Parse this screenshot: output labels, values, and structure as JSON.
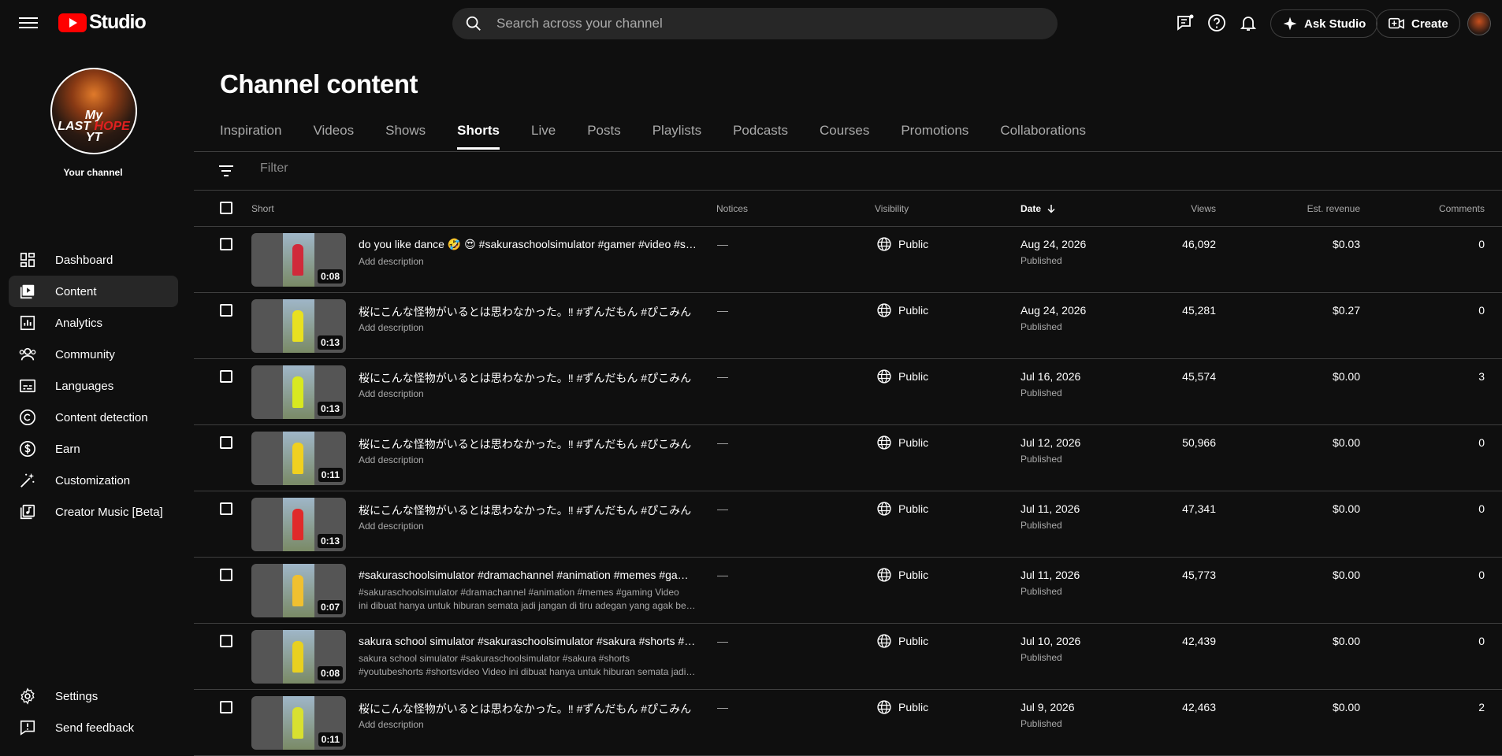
{
  "app": {
    "logo_text": "Studio"
  },
  "search": {
    "placeholder": "Search across your channel"
  },
  "topbar": {
    "ask_studio": "Ask Studio",
    "create": "Create"
  },
  "sidebar": {
    "channel_label": "Your channel",
    "items": [
      {
        "label": "Dashboard",
        "icon": "dashboard-icon"
      },
      {
        "label": "Content",
        "icon": "content-icon",
        "active": true
      },
      {
        "label": "Analytics",
        "icon": "analytics-icon"
      },
      {
        "label": "Community",
        "icon": "community-icon"
      },
      {
        "label": "Languages",
        "icon": "languages-icon"
      },
      {
        "label": "Content detection",
        "icon": "copyright-icon"
      },
      {
        "label": "Earn",
        "icon": "dollar-icon"
      },
      {
        "label": "Customization",
        "icon": "wand-icon"
      },
      {
        "label": "Creator Music [Beta]",
        "icon": "music-icon"
      }
    ],
    "bottom": [
      {
        "label": "Settings",
        "icon": "gear-icon"
      },
      {
        "label": "Send feedback",
        "icon": "feedback-icon"
      }
    ]
  },
  "main": {
    "title": "Channel content",
    "tabs": [
      "Inspiration",
      "Videos",
      "Shows",
      "Shorts",
      "Live",
      "Posts",
      "Playlists",
      "Podcasts",
      "Courses",
      "Promotions",
      "Collaborations"
    ],
    "active_tab": "Shorts",
    "filter_placeholder": "Filter"
  },
  "table": {
    "headers": {
      "short": "Short",
      "notices": "Notices",
      "visibility": "Visibility",
      "date": "Date",
      "views": "Views",
      "revenue": "Est. revenue",
      "comments": "Comments"
    },
    "rows": [
      {
        "title": "do you like dance 🤣 😍 #sakuraschoolsimulator #gamer #video #sakura #shorts",
        "desc1": "Add description",
        "desc2": "",
        "duration": "0:08",
        "notice": "—",
        "visibility": "Public",
        "date": "Aug 24, 2026",
        "status": "Published",
        "views": "46,092",
        "revenue": "$0.03",
        "comments": "0",
        "fig": "#d02a3a"
      },
      {
        "title": "桜にこんな怪物がいるとは思わなかった。‼ #ずんだもん #ぴこみん",
        "desc1": "Add description",
        "desc2": "",
        "duration": "0:13",
        "notice": "—",
        "visibility": "Public",
        "date": "Aug 24, 2026",
        "status": "Published",
        "views": "45,281",
        "revenue": "$0.27",
        "comments": "0",
        "fig": "#e8e020"
      },
      {
        "title": "桜にこんな怪物がいるとは思わなかった。‼ #ずんだもん #ぴこみん",
        "desc1": "Add description",
        "desc2": "",
        "duration": "0:13",
        "notice": "—",
        "visibility": "Public",
        "date": "Jul 16, 2026",
        "status": "Published",
        "views": "45,574",
        "revenue": "$0.00",
        "comments": "3",
        "fig": "#d8e820"
      },
      {
        "title": "桜にこんな怪物がいるとは思わなかった。‼ #ずんだもん #ぴこみん",
        "desc1": "Add description",
        "desc2": "",
        "duration": "0:11",
        "notice": "—",
        "visibility": "Public",
        "date": "Jul 12, 2026",
        "status": "Published",
        "views": "50,966",
        "revenue": "$0.00",
        "comments": "0",
        "fig": "#f0d020"
      },
      {
        "title": "桜にこんな怪物がいるとは思わなかった。‼ #ずんだもん #ぴこみん",
        "desc1": "Add description",
        "desc2": "",
        "duration": "0:13",
        "notice": "—",
        "visibility": "Public",
        "date": "Jul 11, 2026",
        "status": "Published",
        "views": "47,341",
        "revenue": "$0.00",
        "comments": "0",
        "fig": "#e02a2a"
      },
      {
        "title": "#sakuraschoolsimulator #dramachannel #animation #memes #gaming",
        "desc1": "#sakuraschoolsimulator #dramachannel #animation #memes #gaming Video",
        "desc2": "ini dibuat hanya untuk hiburan semata jadi jangan di tiru adegan yang agak berbahaya",
        "duration": "0:07",
        "notice": "—",
        "visibility": "Public",
        "date": "Jul 11, 2026",
        "status": "Published",
        "views": "45,773",
        "revenue": "$0.00",
        "comments": "0",
        "fig": "#f0c030"
      },
      {
        "title": "sakura school simulator #sakuraschoolsimulator #sakura #shorts #youtubeshorts",
        "desc1": "sakura school simulator #sakuraschoolsimulator #sakura #shorts",
        "desc2": "#youtubeshorts #shortsvideo Video ini dibuat hanya untuk hiburan semata jadi jangan di tiru",
        "duration": "0:08",
        "notice": "—",
        "visibility": "Public",
        "date": "Jul 10, 2026",
        "status": "Published",
        "views": "42,439",
        "revenue": "$0.00",
        "comments": "0",
        "fig": "#e8d020"
      },
      {
        "title": "桜にこんな怪物がいるとは思わなかった。‼ #ずんだもん #ぴこみん",
        "desc1": "Add description",
        "desc2": "",
        "duration": "0:11",
        "notice": "—",
        "visibility": "Public",
        "date": "Jul 9, 2026",
        "status": "Published",
        "views": "42,463",
        "revenue": "$0.00",
        "comments": "2",
        "fig": "#d8e030"
      }
    ]
  },
  "colors": {
    "background": "#0f0f0f",
    "surface": "#272727",
    "divider": "#3f3f3f",
    "brand": "#ff0000"
  }
}
